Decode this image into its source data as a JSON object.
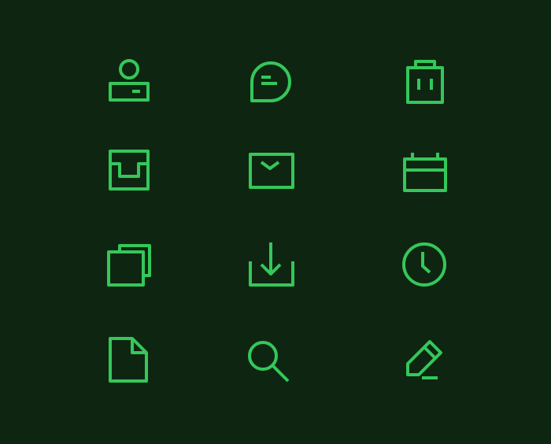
{
  "colors": {
    "background": "#0e2611",
    "icon": "#35c75a"
  },
  "icons": [
    "user-badge-icon",
    "chat-bubble-icon",
    "battery-icon",
    "inbox-tray-icon",
    "mail-envelope-icon",
    "calendar-icon",
    "duplicate-copy-icon",
    "download-tray-icon",
    "clock-icon",
    "document-file-icon",
    "search-icon",
    "pencil-edit-icon"
  ]
}
